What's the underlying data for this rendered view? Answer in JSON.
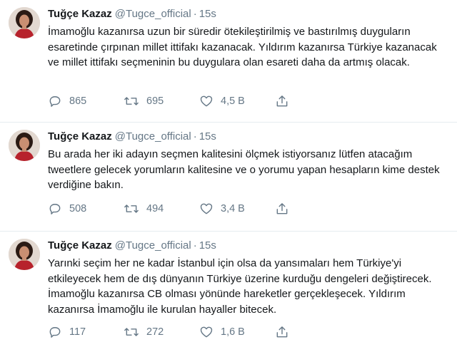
{
  "tweets": [
    {
      "name": "Tuğçe Kazaz",
      "handle": "@Tugce_official",
      "separator": "·",
      "time": "15s",
      "text": "İmamoğlu kazanırsa uzun bir süredir ötekileştirilmiş ve bastırılmış duyguların esaretinde çırpınan millet ittifakı kazanacak. Yıldırım kazanırsa Türkiye kazanacak ve millet ittifakı seçmeninin bu duygulara olan esareti daha da artmış olacak.",
      "replies": "865",
      "retweets": "695",
      "likes": "4,5 B"
    },
    {
      "name": "Tuğçe Kazaz",
      "handle": "@Tugce_official",
      "separator": "·",
      "time": "15s",
      "text": "Bu arada her iki adayın seçmen kalitesini ölçmek istiyorsanız lütfen atacağım tweetlere gelecek yorumların kalitesine ve o yorumu yapan hesapların kime destek verdiğine bakın.",
      "replies": "508",
      "retweets": "494",
      "likes": "3,4 B"
    },
    {
      "name": "Tuğçe Kazaz",
      "handle": "@Tugce_official",
      "separator": "·",
      "time": "15s",
      "text": "Yarınki seçim her ne kadar İstanbul için olsa da yansımaları hem Türkiye'yi etkileyecek hem de dış dünyanın Türkiye üzerine kurduğu dengeleri değiştirecek. İmamoğlu kazanırsa CB olması yönünde hareketler gerçekleşecek. Yıldırım kazanırsa İmamoğlu ile kurulan hayaller bitecek.",
      "replies": "117",
      "retweets": "272",
      "likes": "1,6 B"
    }
  ],
  "icons": {
    "reply": "reply-icon",
    "retweet": "retweet-icon",
    "like": "heart-icon",
    "share": "share-icon"
  },
  "colors": {
    "text": "#14171a",
    "secondary": "#657786",
    "divider": "#e6ecf0"
  }
}
